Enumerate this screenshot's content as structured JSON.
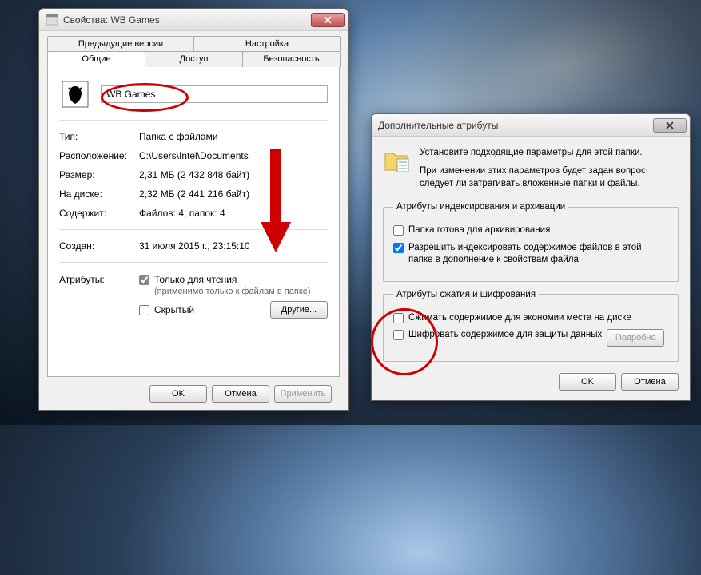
{
  "dlg1": {
    "title": "Свойства: WB Games",
    "tabs_row1": [
      "Предыдущие версии",
      "Настройка"
    ],
    "tabs_row2": [
      "Общие",
      "Доступ",
      "Безопасность"
    ],
    "active_tab": "Общие",
    "folder_name": "WB Games",
    "props": {
      "type_lbl": "Тип:",
      "type_val": "Папка с файлами",
      "loc_lbl": "Расположение:",
      "loc_val": "C:\\Users\\Intel\\Documents",
      "size_lbl": "Размер:",
      "size_val": "2,31 МБ (2 432 848 байт)",
      "ondisk_lbl": "На диске:",
      "ondisk_val": "2,32 МБ (2 441 216 байт)",
      "contains_lbl": "Содержит:",
      "contains_val": "Файлов: 4; папок: 4",
      "created_lbl": "Создан:",
      "created_val": "31 июля 2015 г., 23:15:10",
      "attr_lbl": "Атрибуты:",
      "readonly_lbl": "Только для чтения",
      "readonly_sub": "(применимо только к файлам в папке)",
      "hidden_lbl": "Скрытый",
      "other_btn": "Другие..."
    },
    "buttons": {
      "ok": "OK",
      "cancel": "Отмена",
      "apply": "Применить"
    }
  },
  "dlg2": {
    "title": "Дополнительные атрибуты",
    "info_line1": "Установите подходящие параметры для этой папки.",
    "info_line2": "При изменении этих параметров будет задан вопрос, следует ли затрагивать вложенные папки и файлы.",
    "group1": {
      "legend": "Атрибуты индексирования и архивации",
      "archive_lbl": "Папка готова для архивирования",
      "archive_checked": false,
      "index_lbl": "Разрешить индексировать содержимое файлов в этой папке в дополнение к свойствам файла",
      "index_checked": true
    },
    "group2": {
      "legend": "Атрибуты сжатия и шифрования",
      "compress_lbl": "Сжимать содержимое для экономии места на диске",
      "compress_checked": false,
      "encrypt_lbl": "Шифровать содержимое для защиты данных",
      "encrypt_checked": false,
      "details_btn": "Подробно"
    },
    "buttons": {
      "ok": "OK",
      "cancel": "Отмена"
    }
  }
}
